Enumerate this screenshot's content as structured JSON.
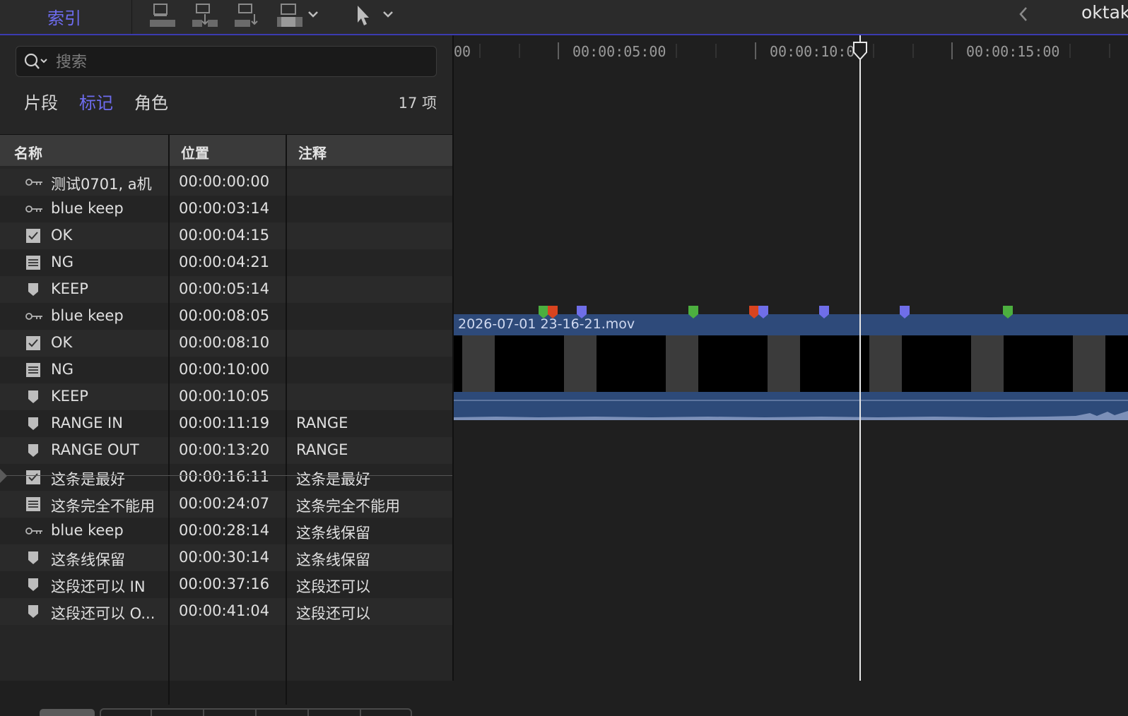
{
  "toolbar": {
    "index_label": "索引",
    "project_name": "oktak"
  },
  "search": {
    "placeholder": "搜索",
    "value": ""
  },
  "tabs": [
    {
      "label": "片段",
      "active": false
    },
    {
      "label": "标记",
      "active": true
    },
    {
      "label": "角色",
      "active": false
    }
  ],
  "item_count": "17 项",
  "columns": {
    "name": "名称",
    "position": "位置",
    "notes": "注释"
  },
  "rows": [
    {
      "icon": "key-icon",
      "name": "测试0701, a机",
      "position": "00:00:00:00",
      "notes": ""
    },
    {
      "icon": "key-icon",
      "name": "blue keep",
      "position": "00:00:03:14",
      "notes": ""
    },
    {
      "icon": "checkbox-checked-icon",
      "name": "OK",
      "position": "00:00:04:15",
      "notes": ""
    },
    {
      "icon": "list-icon",
      "name": "NG",
      "position": "00:00:04:21",
      "notes": ""
    },
    {
      "icon": "marker-icon",
      "name": "KEEP",
      "position": "00:00:05:14",
      "notes": ""
    },
    {
      "icon": "key-icon",
      "name": "blue keep",
      "position": "00:00:08:05",
      "notes": ""
    },
    {
      "icon": "checkbox-checked-icon",
      "name": "OK",
      "position": "00:00:08:10",
      "notes": ""
    },
    {
      "icon": "list-icon",
      "name": "NG",
      "position": "00:00:10:00",
      "notes": ""
    },
    {
      "icon": "marker-icon",
      "name": "KEEP",
      "position": "00:00:10:05",
      "notes": ""
    },
    {
      "icon": "marker-icon",
      "name": "RANGE IN",
      "position": "00:00:11:19",
      "notes": "RANGE"
    },
    {
      "icon": "marker-icon",
      "name": "RANGE OUT",
      "position": "00:00:13:20",
      "notes": "RANGE"
    },
    {
      "icon": "checkbox-checked-icon",
      "name": "这条是最好",
      "position": "00:00:16:11",
      "notes": "这条是最好"
    },
    {
      "icon": "list-icon",
      "name": "这条完全不能用",
      "position": "00:00:24:07",
      "notes": "这条完全不能用"
    },
    {
      "icon": "key-icon",
      "name": "blue keep",
      "position": "00:00:28:14",
      "notes": "这条线保留"
    },
    {
      "icon": "marker-icon",
      "name": "这条线保留",
      "position": "00:00:30:14",
      "notes": "这条线保留"
    },
    {
      "icon": "marker-icon",
      "name": "这段还可以 IN",
      "position": "00:00:37:16",
      "notes": "这段还可以"
    },
    {
      "icon": "marker-icon",
      "name": "这段还可以 O...",
      "position": "00:00:41:04",
      "notes": "这段还可以"
    }
  ],
  "ruler": {
    "labels": [
      "00",
      "00:00:05:00",
      "00:00:10:00",
      "00:00:15:00"
    ]
  },
  "clip": {
    "name": "2026-07-01 23-16-21.mov"
  },
  "marker_colors": {
    "green": "#4caf3f",
    "red": "#d9441f",
    "blue": "#6f6ee8"
  },
  "timeline_markers": [
    {
      "color": "green"
    },
    {
      "color": "red"
    },
    {
      "color": "blue"
    },
    {
      "color": "green"
    },
    {
      "color": "red"
    },
    {
      "color": "blue"
    },
    {
      "color": "blue"
    },
    {
      "color": "blue"
    },
    {
      "color": "green"
    }
  ]
}
